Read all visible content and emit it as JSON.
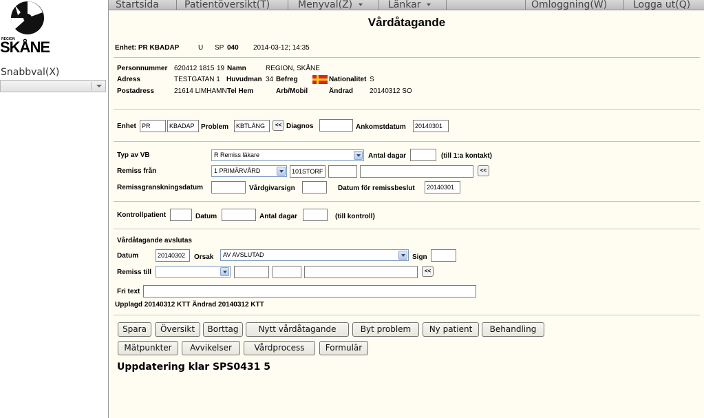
{
  "logo": {
    "region": "REGION",
    "name": "SKÅNE"
  },
  "sidebar": {
    "snabbval_label": "Snabbval(X)",
    "snabbval_value": ""
  },
  "menu": {
    "startsida": "Startsida",
    "patientoversikt": "Patientöversikt(T)",
    "menyval": "Menyval(Z)",
    "lankar": "Länkar",
    "omloggning": "Omloggning(W)",
    "logga_ut": "Logga ut(Q)"
  },
  "page": {
    "title": "Vårdåtagande"
  },
  "enhet_line": {
    "label": "Enhet: PR KBADAP",
    "u": "U",
    "sp_label": "SP",
    "sp_value": "040",
    "datetime": "2014-03-12; 14:35"
  },
  "patient": {
    "personnummer_label": "Personnummer",
    "personnummer": "620412 1815",
    "nr": "19",
    "namn_label": "Namn",
    "namn": "REGION, SKÅNE",
    "adress_label": "Adress",
    "adress": "TESTGATAN 1",
    "huvudman_label": "Huvudman",
    "huvudman": "34",
    "befreg_label": "Befreg",
    "nationalitet_label": "Nationalitet",
    "nationalitet": "S",
    "postadress_label": "Postadress",
    "postadress": "21614 LIMHAMN",
    "telhem_label": "Tel Hem",
    "arbmobil_label": "Arb/Mobil",
    "andrad_label": "Ändrad",
    "andrad": "20140312 SO"
  },
  "problem_row": {
    "enhet_label": "Enhet",
    "enhet1": "PR",
    "enhet2": "KBADAP",
    "problem_label": "Problem",
    "problem": "KBTLÅNG",
    "back": "<<",
    "diagnos_label": "Diagnos",
    "diagnos": "",
    "ankomst_label": "Ankomstdatum",
    "ankomst": "20140301"
  },
  "vb": {
    "typ_label": "Typ av VB",
    "typ_value": "R Remiss läkare",
    "antal_label": "Antal dagar",
    "antal": "",
    "till1a": "(till 1:a kontakt)",
    "remiss_fran_label": "Remiss från",
    "remiss_fran_value": "1 PRIMÄRVÅRD",
    "remiss_code": "101STORF",
    "remiss_f1": "",
    "remiss_f2": "",
    "back": "<<",
    "granskning_label": "Remissgranskningsdatum",
    "granskning": "",
    "vardgivarsign_label": "Vårdgivarsign",
    "vardgivarsign": "",
    "beslut_label": "Datum för remissbeslut",
    "beslut": "20140301"
  },
  "kontroll": {
    "kontrollpatient_label": "Kontrollpatient",
    "kontrollpatient": "",
    "datum_label": "Datum",
    "datum": "",
    "antal_label": "Antal dagar",
    "antal": "",
    "till_kontroll": "(till kontroll)"
  },
  "avslut": {
    "heading": "Vårdåtagande avslutas",
    "datum_label": "Datum",
    "datum": "20140302",
    "orsak_label": "Orsak",
    "orsak_value": "AV AVSLUTAD",
    "sign_label": "Sign",
    "sign": "",
    "remiss_till_label": "Remiss till",
    "remiss_till_value": "",
    "f1": "",
    "f2": "",
    "f3": "",
    "back": "<<",
    "fritext_label": "Fri text",
    "fritext": "",
    "upplagd": "Upplagd 20140312  KTT   Ändrad 20140312  KTT"
  },
  "buttons": {
    "spara": "Spara",
    "oversikt": "Översikt",
    "borttag": "Borttag",
    "nytt": "Nytt vårdåtagande",
    "byt": "Byt problem",
    "ny_patient": "Ny patient",
    "behandling": "Behandling",
    "matpunkter": "Mätpunkter",
    "avvikelser": "Avvikelser",
    "vardprocess": "Vårdprocess",
    "formular": "Formulär"
  },
  "status": {
    "message": "Uppdatering klar SPS0431 5"
  }
}
